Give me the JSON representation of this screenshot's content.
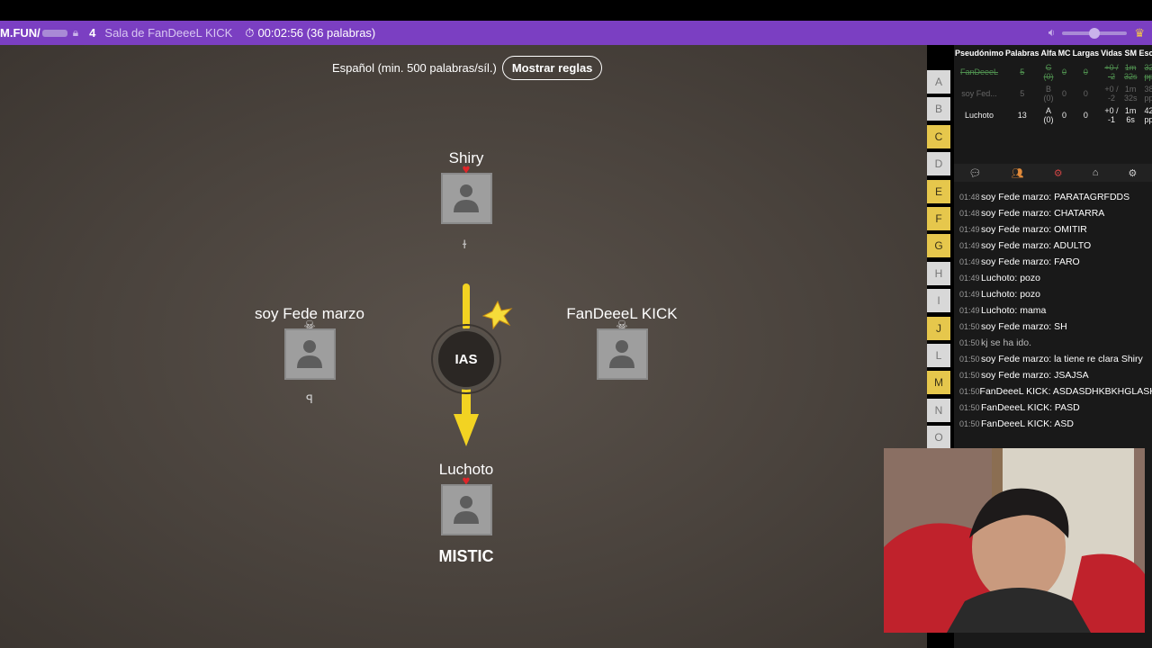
{
  "topbar": {
    "site": "M.FUN/",
    "player_count": "4",
    "room": "Sala de FanDeeeL KICK",
    "timer": "00:02:56 (36 palabras)"
  },
  "game": {
    "language_line": "Español (min. 500 palabras/síl.)",
    "rules_button": "Mostrar reglas",
    "syllable": "IAS",
    "bottom_word": "MISTIC",
    "players": {
      "top": {
        "name": "Shiry",
        "typing": "ɫ",
        "badge": "heart"
      },
      "left": {
        "name": "soy Fede marzo",
        "typing": "ꟼ",
        "badge": "skull"
      },
      "right": {
        "name": "FanDeeeL KICK",
        "typing": "",
        "badge": "skull"
      },
      "bottom": {
        "name": "Luchoto",
        "typing": "",
        "badge": "heart"
      }
    }
  },
  "letters": [
    {
      "l": "A",
      "on": false
    },
    {
      "l": "B",
      "on": false
    },
    {
      "l": "C",
      "on": true
    },
    {
      "l": "D",
      "on": false
    },
    {
      "l": "E",
      "on": true
    },
    {
      "l": "F",
      "on": true
    },
    {
      "l": "G",
      "on": true
    },
    {
      "l": "H",
      "on": false
    },
    {
      "l": "I",
      "on": false
    },
    {
      "l": "J",
      "on": true
    },
    {
      "l": "L",
      "on": false
    },
    {
      "l": "M",
      "on": true
    },
    {
      "l": "N",
      "on": false
    },
    {
      "l": "O",
      "on": false
    }
  ],
  "score_table": {
    "headers": [
      "Pseudónimo",
      "Palabras",
      "Alfa",
      "MC",
      "Largas",
      "Vidas",
      "SM",
      "Escri"
    ],
    "rows": [
      [
        "FanDeeeL",
        "5",
        "C (0)",
        "0",
        "0",
        "+0 / -2",
        "1m 32s",
        "32 pp"
      ],
      [
        "soy Fed...",
        "5",
        "B (0)",
        "0",
        "0",
        "+0 / -2",
        "1m 32s",
        "38 pp"
      ],
      [
        "Luchoto",
        "13",
        "A (0)",
        "0",
        "0",
        "+0 / -1",
        "1m 6s",
        "42 pp"
      ]
    ]
  },
  "chat": [
    {
      "t": "01:48",
      "m": "soy Fede marzo: PARATAGRFDDS"
    },
    {
      "t": "01:48",
      "m": "soy Fede marzo: CHATARRA"
    },
    {
      "t": "01:49",
      "m": "soy Fede marzo: OMITIR"
    },
    {
      "t": "01:49",
      "m": "soy Fede marzo: ADULTO"
    },
    {
      "t": "01:49",
      "m": "soy Fede marzo: FARO"
    },
    {
      "t": "01:49",
      "m": "Luchoto: pozo"
    },
    {
      "t": "01:49",
      "m": "Luchoto: pozo"
    },
    {
      "t": "01:49",
      "m": "Luchoto: mama"
    },
    {
      "t": "01:50",
      "m": "soy Fede marzo: SH"
    },
    {
      "t": "01:50",
      "m": "kj se ha ido."
    },
    {
      "t": "01:50",
      "m": "soy Fede marzo: la tiene re clara Shiry"
    },
    {
      "t": "01:50",
      "m": "soy Fede marzo: JSAJSA"
    },
    {
      "t": "01:50",
      "m": "FanDeeeL KICK: ASDASDHKBKHGLASKHJLSA}"
    },
    {
      "t": "01:50",
      "m": "FanDeeeL KICK: PASD"
    },
    {
      "t": "01:50",
      "m": "FanDeeeL KICK: ASD"
    }
  ]
}
